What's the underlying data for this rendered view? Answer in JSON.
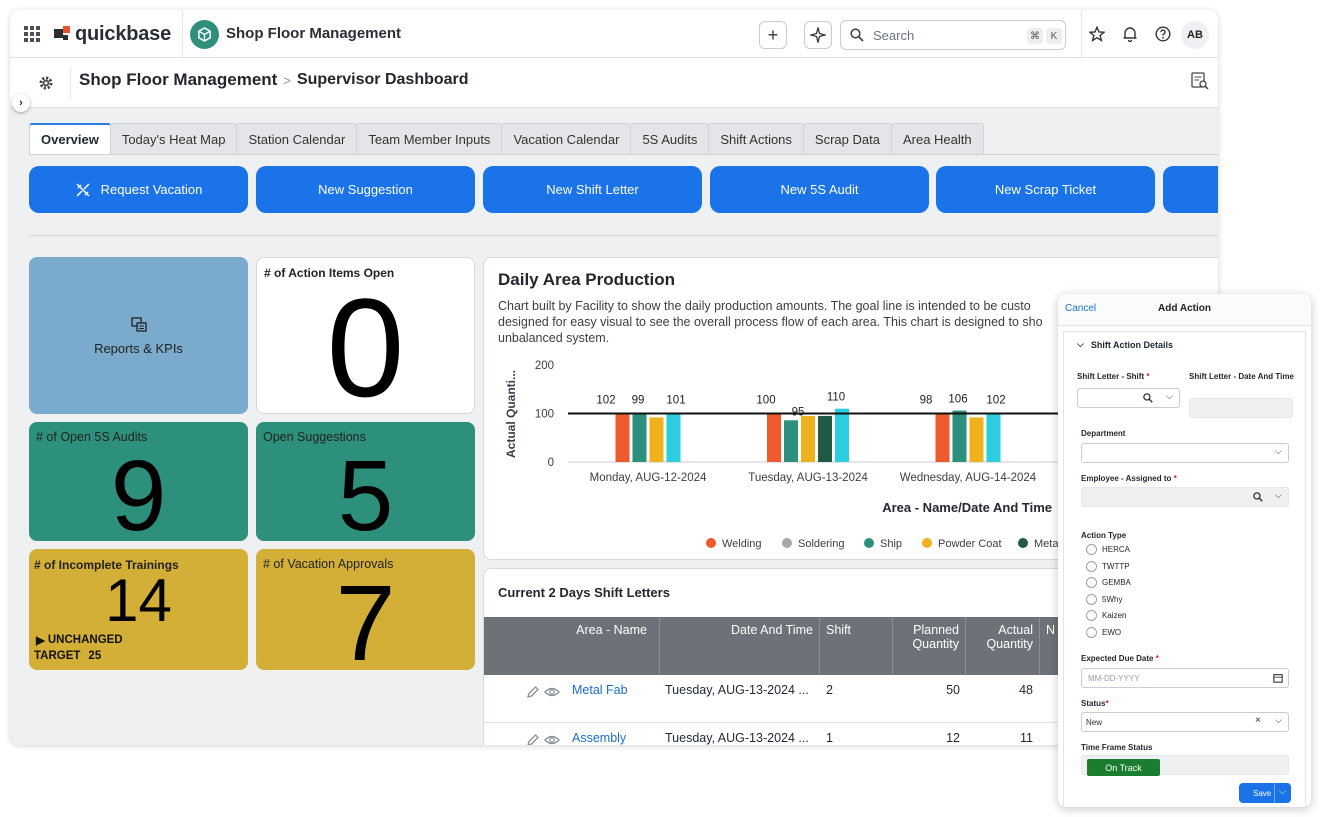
{
  "topbar": {
    "logo_text": "quickbase",
    "app_name": "Shop Floor Management",
    "search_placeholder": "Search",
    "shortcut_keys": [
      "⌘",
      "K"
    ],
    "avatar_initials": "AB"
  },
  "breadcrumb": {
    "app": "Shop Floor Management",
    "separator": ">",
    "page": "Supervisor Dashboard"
  },
  "tabs": [
    {
      "label": "Overview",
      "active": true
    },
    {
      "label": "Today's Heat Map"
    },
    {
      "label": "Station Calendar"
    },
    {
      "label": "Team Member Inputs"
    },
    {
      "label": "Vacation Calendar"
    },
    {
      "label": "5S Audits"
    },
    {
      "label": "Shift Actions"
    },
    {
      "label": "Scrap Data"
    },
    {
      "label": "Area Health"
    }
  ],
  "action_buttons": [
    {
      "label": "Request Vacation",
      "icon": "plane-icon"
    },
    {
      "label": "New Suggestion"
    },
    {
      "label": "New Shift Letter"
    },
    {
      "label": "New 5S Audit"
    },
    {
      "label": "New Scrap Ticket"
    }
  ],
  "tiles": {
    "reports": {
      "label": "Reports & KPIs"
    },
    "action_items": {
      "label": "# of Action Items Open",
      "value": "0"
    },
    "audits": {
      "label": "# of Open 5S Audits",
      "value": "9"
    },
    "suggestions": {
      "label": "Open Suggestions",
      "value": "5"
    },
    "trainings": {
      "label": "# of Incomplete Trainings",
      "value": "14",
      "trend": "UNCHANGED",
      "target_label": "TARGET",
      "target_value": "25"
    },
    "vacations": {
      "label": "# of Vacation Approvals",
      "value": "7"
    }
  },
  "colors": {
    "accent": "#1a73e8",
    "reports_tile": "#7aabcc",
    "teal_tile": "#2c907c",
    "gold_tile": "#d4af38",
    "welding": "#ee5a2c",
    "soldering": "#a8a8a8",
    "ship": "#2c907c",
    "powder_coat": "#f0b21c",
    "metal": "#1e5a46",
    "extra_series": "#2dcde0"
  },
  "chart_panel": {
    "title": "Daily Area Production",
    "description": "Chart built by Facility to show the daily production amounts. The goal line is intended to be custo designed for easy visual to see the overall process flow of each area. This chart is designed to sho unbalanced system."
  },
  "chart_data": {
    "type": "bar",
    "categories": [
      "Monday, AUG-12-2024",
      "Tuesday, AUG-13-2024",
      "Wednesday, AUG-14-2024"
    ],
    "ylabel": "Actual Quanti...",
    "xlabel": "Area - Name/Date And Time",
    "yticks": [
      0,
      100,
      200
    ],
    "ylim": [
      0,
      200
    ],
    "goal_line": 100,
    "legend": [
      "Welding",
      "Soldering",
      "Ship",
      "Powder Coat",
      "Metal"
    ],
    "series": [
      {
        "name": "Welding",
        "color": "#ee5a2c",
        "values": [
          102,
          100,
          98
        ]
      },
      {
        "name": "Ship",
        "color": "#2c907c",
        "values": [
          99,
          86,
          106
        ]
      },
      {
        "name": "Powder Coat",
        "color": "#f0b21c",
        "values": [
          92,
          95,
          92
        ]
      },
      {
        "name": "Metal",
        "color": "#1e5a46",
        "values": [
          null,
          95,
          null
        ]
      },
      {
        "color": "#2dcde0",
        "values": [
          101,
          110,
          102
        ]
      }
    ],
    "data_labels": [
      [
        102,
        99,
        101
      ],
      [
        100,
        95,
        110
      ],
      [
        98,
        106,
        102
      ]
    ]
  },
  "table": {
    "title": "Current 2 Days Shift Letters",
    "columns": [
      "Area - Name",
      "Date And Time",
      "Shift",
      "Planned Quantity",
      "Actual Quantity",
      "N"
    ],
    "rows": [
      {
        "area": "Metal Fab",
        "date": "Tuesday, AUG-13-2024 ...",
        "shift": "2",
        "planned": "50",
        "actual": "48"
      },
      {
        "area": "Assembly",
        "date": "Tuesday, AUG-13-2024 ...",
        "shift": "1",
        "planned": "12",
        "actual": "11"
      }
    ]
  },
  "side_panel": {
    "cancel": "Cancel",
    "title": "Add Action",
    "section": "Shift Action Details",
    "shift_letter_label": "Shift Letter - Shift",
    "shift_letter_date_label": "Shift Letter - Date And Time",
    "department_label": "Department",
    "employee_label": "Employee - Assigned to",
    "action_type_label": "Action Type",
    "action_types": [
      "HERCA",
      "TWTTP",
      "GEMBA",
      "5Why",
      "Kaizen",
      "EWO"
    ],
    "due_date_label": "Expected Due Date",
    "due_date_placeholder": "MM-DD-YYYY",
    "status_label": "Status",
    "status_value": "New",
    "time_frame_label": "Time Frame Status",
    "time_frame_value": "On Track",
    "save": "Save"
  }
}
